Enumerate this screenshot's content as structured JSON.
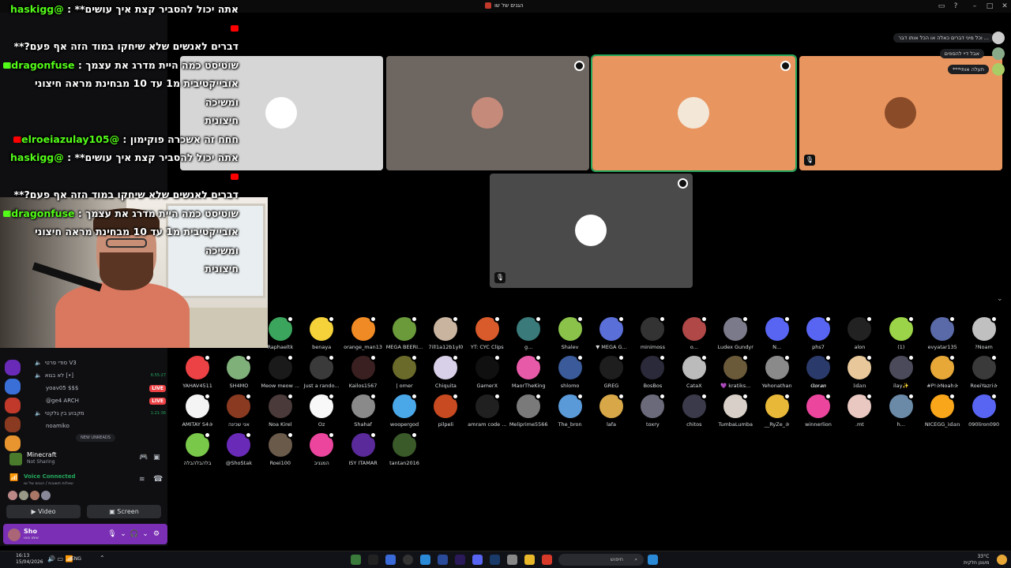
{
  "window": {
    "title": "הגנים של שו"
  },
  "chat": [
    {
      "platform": "youtube",
      "user": "@haskigg",
      "text": "אתה יכול להסביר קצת איך עושים** :"
    },
    {
      "platform": "",
      "user": "",
      "text": "דברים לאנשים שלא שיחקו במוד הזה אף פעם?**"
    },
    {
      "platform": "kick",
      "user": "dragonfuse",
      "text": "שוטיסט כמה היית מדרג את עצמך :"
    },
    {
      "platform": "",
      "user": "",
      "text": "אובייקטיבית מ1 עד 10 מבחינת מראה חיצוני ומשיכה"
    },
    {
      "platform": "",
      "user": "",
      "text": "חיצונית"
    },
    {
      "platform": "youtube",
      "user": "@elroeiazulay105",
      "text": "חחח זה אשכרה פוקימון :"
    },
    {
      "platform": "youtube",
      "user": "@haskigg",
      "text": "אתה יכול להסביר קצת איך עושים** :"
    },
    {
      "platform": "",
      "user": "",
      "text": "דברים לאנשים שלא שיחקו במוד הזה אף פעם?**"
    },
    {
      "platform": "kick",
      "user": "dragonfuse",
      "text": "שוטיסט כמה היית מדרג את עצמך :"
    },
    {
      "platform": "",
      "user": "",
      "text": "אובייקטיבית מ1 עד 10 מבחינת מראה חיצוני ומשיכה"
    },
    {
      "platform": "",
      "user": "",
      "text": "חיצונית"
    }
  ],
  "notifications": [
    "... וכל מיני דברים כאלה או הכל אותו דבר",
    "אבל דיי להספים",
    "תעלה אותי***"
  ],
  "sidebar": {
    "voice_channels": [
      {
        "label": "סודי פרטי V3",
        "live": "",
        "time": ""
      },
      {
        "label": "לא בגוא [•]",
        "live": "",
        "time": "6:55:27"
      },
      {
        "label": "yoav05 $$$",
        "live": "LIVE",
        "time": ""
      },
      {
        "label": "@ge4 ARCH",
        "live": "LIVE",
        "time": ""
      },
      {
        "label": "מקבוע בין גלקטי",
        "live": "",
        "time": "1:21:36"
      },
      {
        "label": "noamiko",
        "live": "",
        "time": ""
      }
    ],
    "new_unreads": "NEW UNREADS",
    "activity": {
      "name": "Minecraft",
      "status": "Not Sharing"
    },
    "voice": {
      "status": "Voice Connected",
      "channel": "שאלות תשובות / הגנים של שו"
    },
    "video_label": "Video",
    "screen_label": "Screen",
    "user": {
      "name": "Sho",
      "status": "שימו טאו"
    }
  },
  "stage_tiles": [
    {
      "bg": "#d6d6d6",
      "avatar": "#ffffff",
      "menu": false,
      "mute": false
    },
    {
      "bg": "#6e6660",
      "avatar": "#c58a7a",
      "menu": true,
      "mute": false
    },
    {
      "bg": "#e8955f",
      "avatar": "#f3e7d8",
      "menu": true,
      "mute": false
    },
    {
      "bg": "#e8955f",
      "avatar": "#8a4b28",
      "menu": false,
      "mute": true
    },
    {
      "bg": "#4a4a4a",
      "avatar": "#ffffff",
      "menu": true,
      "mute": true
    }
  ],
  "audience": [
    {
      "name": "Raphaeltk",
      "color": "#3ba55d"
    },
    {
      "name": "benaya",
      "color": "#f5d23a"
    },
    {
      "name": "orange_man13",
      "color": "#f08a24"
    },
    {
      "name": "MEGA BEERI...",
      "color": "#6a9a3a"
    },
    {
      "name": "7ill1a12b1yl0",
      "color": "#c9b4a0"
    },
    {
      "name": "YT: CYC Clips",
      "color": "#d95a2b"
    },
    {
      "name": "g...",
      "color": "#3a7a7a"
    },
    {
      "name": "Shalev",
      "color": "#8bc34a"
    },
    {
      "name": "▼ MEGA G...",
      "color": "#5b6fd8"
    },
    {
      "name": "minimoss",
      "color": "#333333"
    },
    {
      "name": "o...",
      "color": "#b04848"
    },
    {
      "name": "Ludex Gundyr",
      "color": "#7a7a8a"
    },
    {
      "name": "N...",
      "color": "#5865f2"
    },
    {
      "name": "phs7",
      "color": "#5865f2"
    },
    {
      "name": "alon",
      "color": "#222222"
    },
    {
      "name": "(1)",
      "color": "#9bd448"
    },
    {
      "name": "evyatar135",
      "color": "#5a6aa8"
    },
    {
      "name": "?Noam",
      "color": "#c0c0c0"
    },
    {
      "name": "YAHAV4511",
      "color": "#ed4245"
    },
    {
      "name": "SH4MO",
      "color": "#7fb07a"
    },
    {
      "name": "Meow meow ...",
      "color": "#1a1a1a"
    },
    {
      "name": "Just a rando...",
      "color": "#3a3a3a"
    },
    {
      "name": "Kailos1567",
      "color": "#3a2020"
    },
    {
      "name": "| omer",
      "color": "#6a6a2a"
    },
    {
      "name": "Chiquita",
      "color": "#d8d0e8"
    },
    {
      "name": "GamerX",
      "color": "#101010"
    },
    {
      "name": "MaorTheKing",
      "color": "#e75aa8"
    },
    {
      "name": "shlomo",
      "color": "#3a5a9a"
    },
    {
      "name": "GREG",
      "color": "#1e1e1e"
    },
    {
      "name": "BosBos",
      "color": "#2a2a3a"
    },
    {
      "name": "CataX",
      "color": "#bbbbbb"
    },
    {
      "name": "💜 kratiks...",
      "color": "#6a5a3a"
    },
    {
      "name": "Yehonathan",
      "color": "#8a8a8a"
    },
    {
      "name": "𝑮𝒐𝒓𝒂𝒏",
      "color": "#2a3a6a"
    },
    {
      "name": "𝕀𝕕𝕒𝕟",
      "color": "#e8c89a"
    },
    {
      "name": "ilay✨ ",
      "color": "#4a4a5a"
    },
    {
      "name": "#P!✰Noah✰",
      "color": "#e8a838"
    },
    {
      "name": "RoeiYazri✰",
      "color": "#3a3a3a"
    },
    {
      "name": "AMITAY S4✰",
      "color": "#f4f4f4"
    },
    {
      "name": "אני שכינה",
      "color": "#8a3a20"
    },
    {
      "name": "Noa Kirel",
      "color": "#4a3a3a"
    },
    {
      "name": "Oz",
      "color": "#f8f8f8"
    },
    {
      "name": "Shahaf",
      "color": "#8a8a8a"
    },
    {
      "name": "woopergod",
      "color": "#4aa8e8"
    },
    {
      "name": "pilpeli",
      "color": "#c84a20"
    },
    {
      "name": "amram code ...",
      "color": "#202020"
    },
    {
      "name": "Meliprime5566",
      "color": "#7a7a7a"
    },
    {
      "name": "The_bron",
      "color": "#5a9ad8"
    },
    {
      "name": "lafa",
      "color": "#d8a848"
    },
    {
      "name": "toxry",
      "color": "#6a6a7a"
    },
    {
      "name": "chitos",
      "color": "#3a3a4a"
    },
    {
      "name": "TumbaLumba",
      "color": "#d8d0c8"
    },
    {
      "name": "__RyZe_✰",
      "color": "#e8b838"
    },
    {
      "name": "winnerlion",
      "color": "#eb459e"
    },
    {
      "name": ".mt",
      "color": "#e8c8c0"
    },
    {
      "name": "h...",
      "color": "#6a8aa8"
    },
    {
      "name": "NICEGG_𝕚𝕕𝕒𝕟",
      "color": "#faa61a"
    },
    {
      "name": "090liron090",
      "color": "#5865f2"
    },
    {
      "name": "בלהבלהבלה",
      "color": "#7ac84a"
    },
    {
      "name": "@ShoStak",
      "color": "#6a2ab8"
    },
    {
      "name": "Roei100",
      "color": "#6a5a4a"
    },
    {
      "name": "המגניב",
      "color": "#eb459e"
    },
    {
      "name": "ISY ITAMAR",
      "color": "#5a2a9a"
    },
    {
      "name": "tantan2016",
      "color": "#3a5a2a"
    }
  ],
  "taskbar": {
    "time": "16:13",
    "date": "15/04/2026",
    "lang": "ENG",
    "search_placeholder": "חיפוש",
    "weather_temp": "33°C",
    "weather_text": "מעונן חלקית"
  }
}
